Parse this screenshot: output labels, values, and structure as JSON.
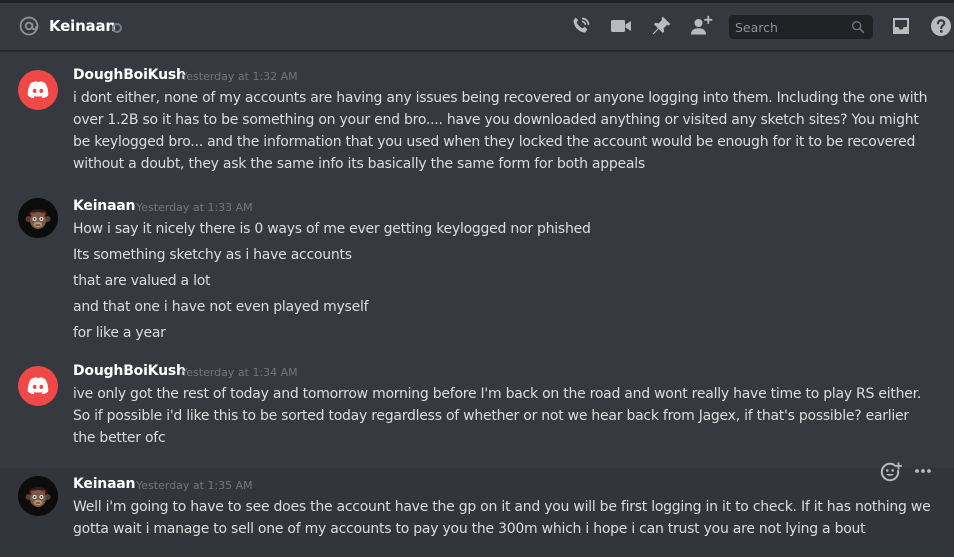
{
  "header": {
    "channel_name": "Keinaan",
    "search_placeholder": "Search"
  },
  "messages": [
    {
      "author": "DoughBoiKush",
      "timestamp": "Yesterday at 1:32 AM",
      "avatar": "discord-logo",
      "lines": [
        "i dont either, none of my accounts are having any issues being recovered or anyone logging into them. Including the one with",
        "over 1.2B so it has to be something on your end bro.... have you downloaded anything or visited any sketch sites? You might",
        "be keylogged bro... and the information that you used when they locked the account would be enough for it to be recovered",
        "without a doubt, they ask the same info its basically the same form for both appeals"
      ]
    },
    {
      "author": "Keinaan",
      "timestamp": "Yesterday at 1:33 AM",
      "avatar": "monkey-face",
      "lines": [
        "How i say it nicely there is 0 ways of me ever getting keylogged nor phished",
        "Its something sketchy as i have accounts",
        "that are valued a lot",
        "and that one i have not even played myself",
        "for like a year"
      ]
    },
    {
      "author": "DoughBoiKush",
      "timestamp": "Yesterday at 1:34 AM",
      "avatar": "discord-logo",
      "lines": [
        "ive only got the rest of today and tomorrow morning before I'm back on the road and wont really have time to play RS either.",
        "So if possible i'd like this to be sorted today regardless of whether or not we hear back from Jagex, if that's possible? earlier",
        "the better ofc"
      ]
    },
    {
      "author": "Keinaan",
      "timestamp": "Yesterday at 1:35 AM",
      "avatar": "monkey-face",
      "lines": [
        "Well i'm going to have to see does the account have the gp on it and you will be first logging in it to check. If it has nothing we",
        "gotta wait i manage to sell one of my accounts to pay you the 300m which i hope i can trust you are not lying a bout"
      ]
    }
  ],
  "icons": {
    "header": [
      "at-icon",
      "status-dot",
      "call-icon",
      "video-icon",
      "pin-icon",
      "add-member-icon",
      "search-icon",
      "inbox-icon",
      "help-icon"
    ],
    "toolbar": [
      "add-reaction-icon",
      "more-icon"
    ]
  },
  "colors": {
    "background": "#36393f",
    "header_icon": "#b9bbbe",
    "username": "#ffffff",
    "timestamp": "#72767d",
    "message_text": "#dcddde",
    "discord_avatar": "#f04747",
    "hover_row": "#32353b",
    "search_bg": "#202225"
  }
}
